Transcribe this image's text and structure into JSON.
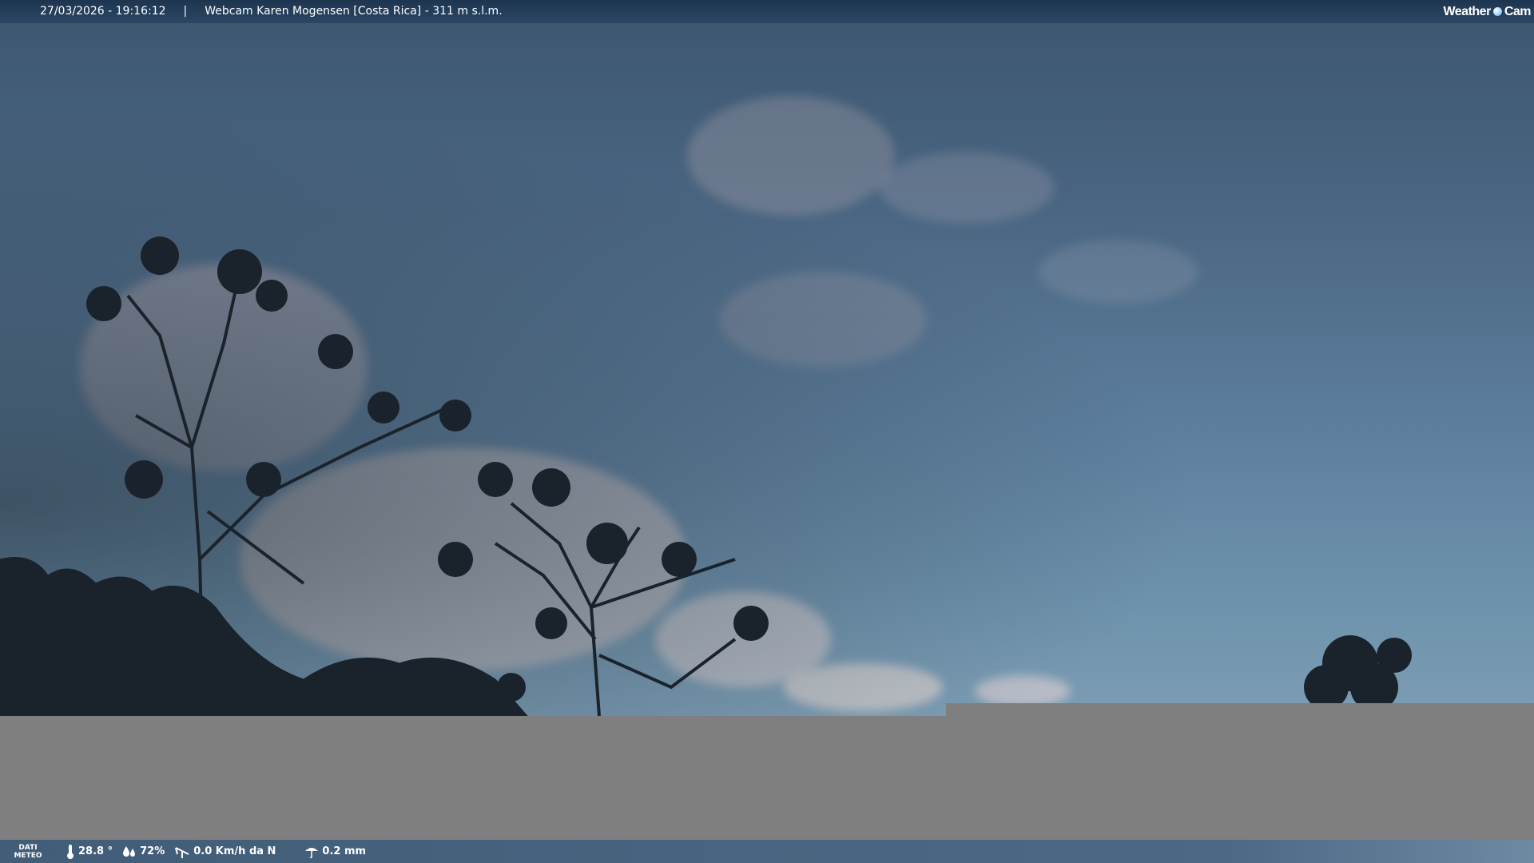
{
  "topbar": {
    "timestamp": "27/03/2026 - 19:16:12",
    "separator": "|",
    "location": "Webcam Karen Mogensen [Costa Rica]  - 311 m s.l.m.",
    "brand_left": "Weather",
    "brand_right": "Cam"
  },
  "bottombar": {
    "label_line1": "DATI",
    "label_line2": "METEO",
    "temperature": "28.8 °",
    "humidity": "72%",
    "wind": "0.0 Km/h da N",
    "rain": "0.2 mm"
  },
  "icons": [
    "thermometer-icon",
    "humidity-icon",
    "wind-icon",
    "rain-icon",
    "weathercam-logo-icon"
  ]
}
